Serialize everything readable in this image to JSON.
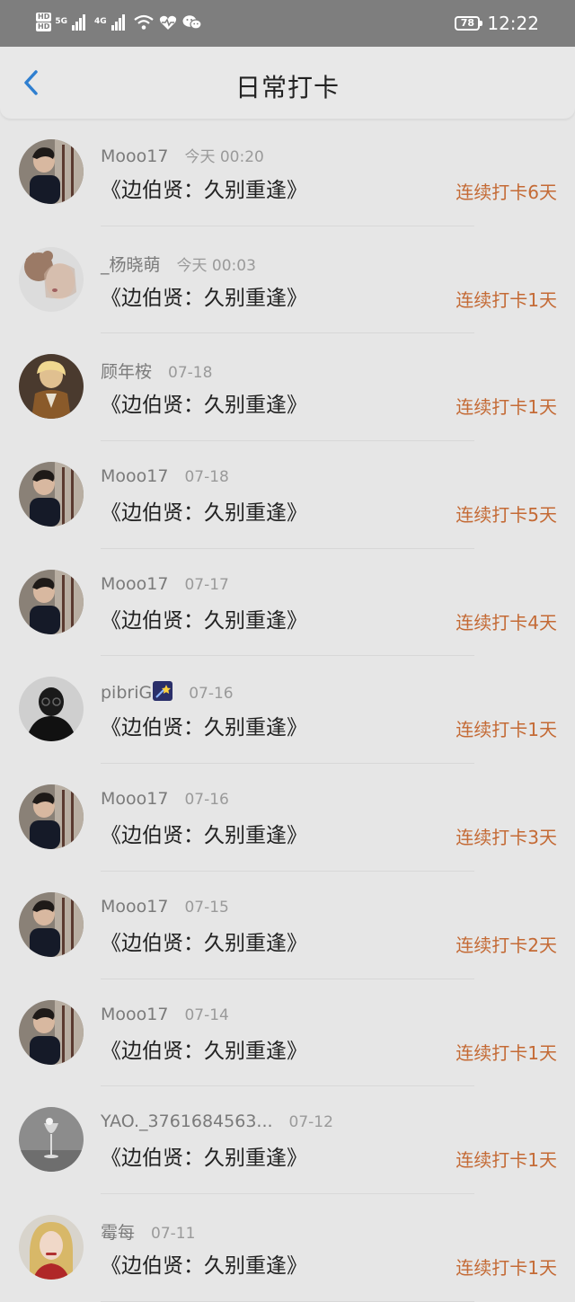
{
  "status_bar": {
    "hd1": "HD",
    "hd2": "HD",
    "net1": "5G",
    "net2": "4G",
    "battery": "78",
    "time": "12:22",
    "icons": [
      "wifi-icon",
      "heart-pulse-icon",
      "wechat-icon"
    ]
  },
  "header": {
    "title": "日常打卡",
    "back_icon": "chevron-left-icon"
  },
  "colors": {
    "background": "#e6e6e6",
    "status_bar": "#7e7e7e",
    "streak": "#c46a35",
    "back_icon": "#2f7fd0"
  },
  "entries": [
    {
      "user": "Mooo17",
      "time": "今天 00:20",
      "title": "《边伯贤：久别重逢》",
      "streak": "连续打卡6天",
      "avatar": "man-dark-hair-avatar"
    },
    {
      "user": "_杨晓萌",
      "time": "今天 00:03",
      "title": "《边伯贤：久别重逢》",
      "streak": "连续打卡1天",
      "avatar": "girl-with-bear-avatar"
    },
    {
      "user": "顾年桉",
      "time": "07-18",
      "title": "《边伯贤：久别重逢》",
      "streak": "连续打卡1天",
      "avatar": "blonde-person-avatar"
    },
    {
      "user": "Mooo17",
      "time": "07-18",
      "title": "《边伯贤：久别重逢》",
      "streak": "连续打卡5天",
      "avatar": "man-dark-hair-avatar"
    },
    {
      "user": "Mooo17",
      "time": "07-17",
      "title": "《边伯贤：久别重逢》",
      "streak": "连续打卡4天",
      "avatar": "man-dark-hair-avatar"
    },
    {
      "user": "pibriG",
      "time": "07-16",
      "title": "《边伯贤：久别重逢》",
      "streak": "连续打卡1天",
      "avatar": "dark-silhouette-avatar",
      "emoji": "shooting-star-icon"
    },
    {
      "user": "Mooo17",
      "time": "07-16",
      "title": "《边伯贤：久别重逢》",
      "streak": "连续打卡3天",
      "avatar": "man-dark-hair-avatar"
    },
    {
      "user": "Mooo17",
      "time": "07-15",
      "title": "《边伯贤：久别重逢》",
      "streak": "连续打卡2天",
      "avatar": "man-dark-hair-avatar"
    },
    {
      "user": "Mooo17",
      "time": "07-14",
      "title": "《边伯贤：久别重逢》",
      "streak": "连续打卡1天",
      "avatar": "man-dark-hair-avatar"
    },
    {
      "user": "YAO._3761684563...",
      "time": "07-12",
      "title": "《边伯贤：久别重逢》",
      "streak": "连续打卡1天",
      "avatar": "wine-glass-avatar"
    },
    {
      "user": "霉每",
      "time": "07-11",
      "title": "《边伯贤：久别重逢》",
      "streak": "连续打卡1天",
      "avatar": "blonde-woman-avatar"
    }
  ]
}
